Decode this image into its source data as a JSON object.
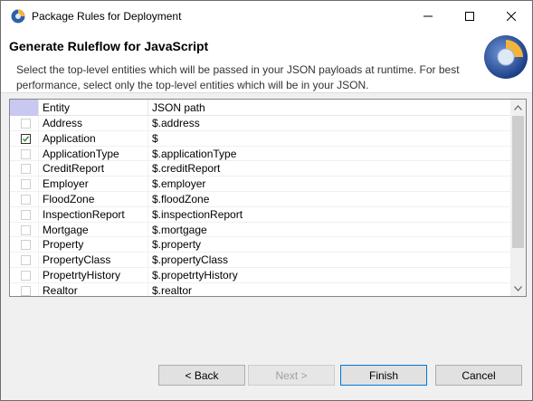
{
  "window": {
    "title": "Package Rules for Deployment"
  },
  "header": {
    "title": "Generate Ruleflow for JavaScript",
    "description": "Select the top-level entities which will be passed in your JSON payloads at runtime.  For best performance, select only the top-level entities which will be in your JSON."
  },
  "table": {
    "columns": [
      "Entity",
      "JSON path"
    ],
    "rows": [
      {
        "entity": "Address",
        "path": "$.address",
        "checked": false
      },
      {
        "entity": "Application",
        "path": "$",
        "checked": true
      },
      {
        "entity": "ApplicationType",
        "path": "$.applicationType",
        "checked": false
      },
      {
        "entity": "CreditReport",
        "path": "$.creditReport",
        "checked": false
      },
      {
        "entity": "Employer",
        "path": "$.employer",
        "checked": false
      },
      {
        "entity": "FloodZone",
        "path": "$.floodZone",
        "checked": false
      },
      {
        "entity": "InspectionReport",
        "path": "$.inspectionReport",
        "checked": false
      },
      {
        "entity": "Mortgage",
        "path": "$.mortgage",
        "checked": false
      },
      {
        "entity": "Property",
        "path": "$.property",
        "checked": false
      },
      {
        "entity": "PropertyClass",
        "path": "$.propertyClass",
        "checked": false
      },
      {
        "entity": "PropetrtyHistory",
        "path": "$.propetrtyHistory",
        "checked": false
      },
      {
        "entity": "Realtor",
        "path": "$.realtor",
        "checked": false
      }
    ]
  },
  "buttons": {
    "back": "< Back",
    "next": "Next >",
    "finish": "Finish",
    "cancel": "Cancel"
  },
  "colors": {
    "accent": "#0078d7",
    "header_check_column": "#c9c8f0"
  }
}
